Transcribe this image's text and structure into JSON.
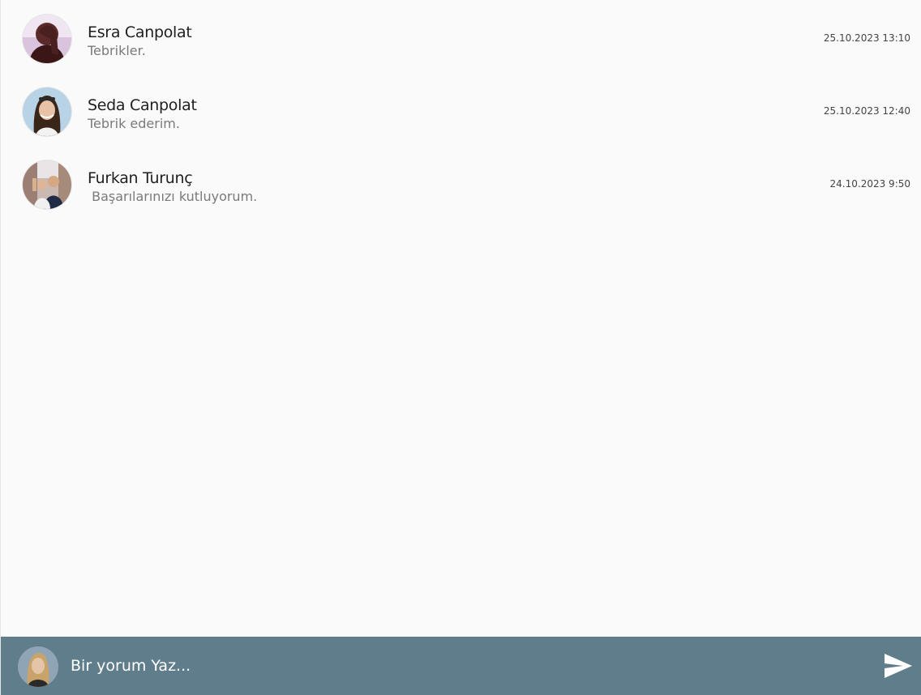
{
  "comments": [
    {
      "name": "Esra Canpolat",
      "text": "Tebrikler.",
      "time": "25.10.2023 13:10"
    },
    {
      "name": "Seda Canpolat",
      "text": "Tebrik ederim.",
      "time": "25.10.2023 12:40"
    },
    {
      "name": "Furkan Turunç",
      "text": " Başarılarınızı kutluyorum.",
      "time": "24.10.2023 9:50"
    }
  ],
  "composer": {
    "placeholder": "Bir yorum Yaz...",
    "send_icon": "send-icon"
  },
  "colors": {
    "background": "#fafafa",
    "composer_bar": "#607d8b",
    "name_text": "#1f1f1f",
    "comment_text": "#7a7a7a"
  }
}
